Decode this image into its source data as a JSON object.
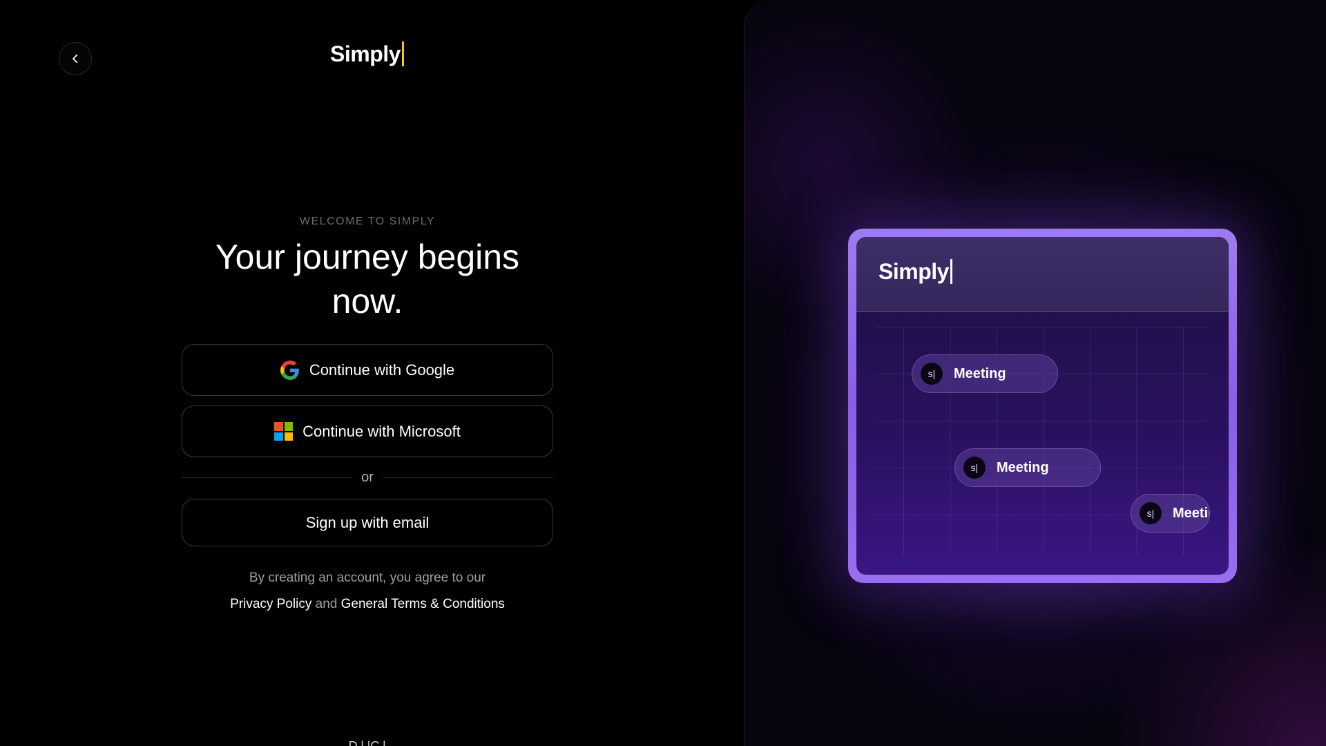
{
  "brand": {
    "name": "Simply"
  },
  "nav": {
    "back_icon": "chevron-left-icon"
  },
  "intro": {
    "eyebrow": "WELCOME TO SIMPLY",
    "headline_line1": "Your journey begins",
    "headline_line2": "now."
  },
  "auth": {
    "google_label": "Continue with Google",
    "microsoft_label": "Continue with Microsoft",
    "divider_label": "or",
    "email_label": "Sign up with email"
  },
  "legal": {
    "prefix": "By creating an account, you agree to our",
    "privacy_link": "Privacy Policy",
    "conjunction": "and",
    "terms_link": "General Terms & Conditions"
  },
  "footer": {
    "partial_text": "D      l              |C    l"
  },
  "preview": {
    "logo": "Simply",
    "events": [
      {
        "avatar": "s|",
        "label": "Meeting"
      },
      {
        "avatar": "s|",
        "label": "Meeting"
      },
      {
        "avatar": "s|",
        "label": "Meetin"
      }
    ]
  },
  "colors": {
    "background": "#000000",
    "cursor_accent": "#f5c518",
    "card_border": "#9f7bf0",
    "panel_glow": "#5828a0",
    "google_blue": "#4285F4",
    "google_red": "#EA4335",
    "google_yellow": "#FBBC05",
    "google_green": "#34A853",
    "ms_red": "#F25022",
    "ms_green": "#7FBA00",
    "ms_blue": "#00A4EF",
    "ms_yellow": "#FFB900"
  }
}
